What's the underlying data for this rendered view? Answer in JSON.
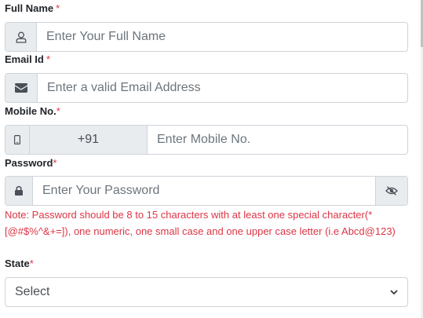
{
  "full_name": {
    "label": "Full Name",
    "required_mark": "*",
    "placeholder": "Enter Your Full Name",
    "icon": "user-icon"
  },
  "email": {
    "label": "Email Id",
    "required_mark": "*",
    "placeholder": "Enter a valid Email Address",
    "icon": "envelope-icon"
  },
  "mobile": {
    "label": "Mobile No.",
    "required_mark": "*",
    "country_code": "+91",
    "placeholder": "Enter Mobile No.",
    "icon": "mobile-icon"
  },
  "password": {
    "label": "Password",
    "required_mark": "*",
    "placeholder": "Enter Your Password",
    "icon": "lock-icon",
    "toggle_icon": "eye-slash-icon",
    "note": "Note: Password should be 8 to 15 characters with at least one special character(*[@#$%^&+=]), one numeric, one small case and one upper case letter (i.e Abcd@123)"
  },
  "state": {
    "label": "State",
    "required_mark": "*",
    "selected": "Select"
  },
  "colors": {
    "required": "#dc3545",
    "border": "#ced4da",
    "addon_bg": "#e9ecef"
  }
}
